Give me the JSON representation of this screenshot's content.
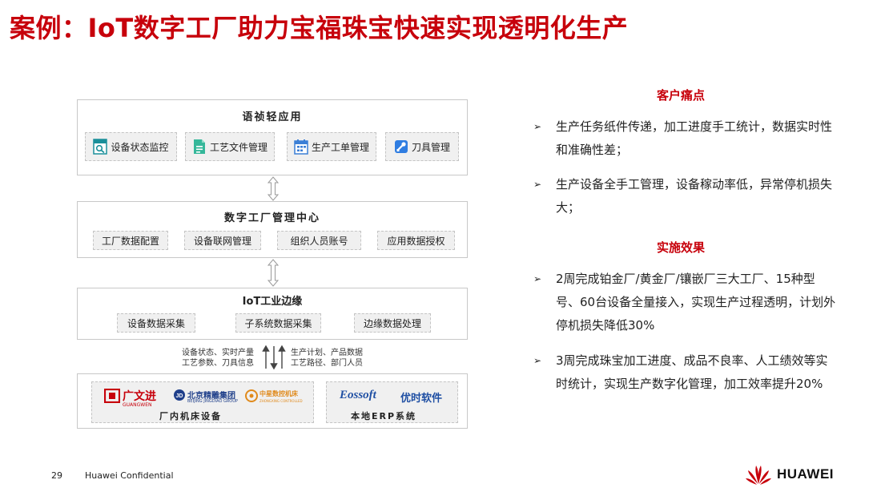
{
  "title": "案例：IoT数字工厂助力宝福珠宝快速实现透明化生产",
  "diagram": {
    "app_layer": {
      "title": "语祯轻应用",
      "apps": [
        {
          "label": "设备状态监控",
          "icon": "monitor-search-icon"
        },
        {
          "label": "工艺文件管理",
          "icon": "document-icon"
        },
        {
          "label": "生产工单管理",
          "icon": "calendar-icon"
        },
        {
          "label": "刀具管理",
          "icon": "tool-icon"
        }
      ]
    },
    "center_layer": {
      "title": "数字工厂管理中心",
      "items": [
        "工厂数据配置",
        "设备联网管理",
        "组织人员账号",
        "应用数据授权"
      ]
    },
    "edge_layer": {
      "title": "IoT工业边缘",
      "items": [
        "设备数据采集",
        "子系统数据采集",
        "边缘数据处理"
      ]
    },
    "flow": {
      "up_lines": [
        "设备状态、实时产量",
        "工艺参数、刀具信息"
      ],
      "down_lines": [
        "生产计划、产品数据",
        "工艺路径、部门人员"
      ]
    },
    "bottom": {
      "machine_caption": "厂内机床设备",
      "machine_brands": [
        {
          "name": "广文进",
          "sub": "GUANGWEN"
        },
        {
          "name": "北京精雕集团",
          "sub": "BEIJING JINGDIAO GROUP"
        },
        {
          "name": "中星数控机床",
          "sub": "ZHONGXING CONTROLLED"
        }
      ],
      "erp_caption": "本地ERP系统",
      "erp_brand": "Eossoft",
      "erp_brand_cn": "优时软件"
    }
  },
  "pain_points": {
    "heading": "客户痛点",
    "items": [
      "生产任务纸件传递，加工进度手工统计，数据实时性和准确性差；",
      "生产设备全手工管理，设备稼动率低，异常停机损失大；"
    ]
  },
  "effects": {
    "heading": "实施效果",
    "items": [
      "2周完成铂金厂/黄金厂/镶嵌厂三大工厂、15种型号、60台设备全量接入，实现生产过程透明，计划外停机损失降低30%",
      "3周完成珠宝加工进度、成品不良率、人工绩效等实时统计，实现生产数字化管理，加工效率提升20%"
    ]
  },
  "footer": {
    "page_number": "29",
    "confidential": "Huawei Confidential",
    "logo_text": "HUAWEI"
  },
  "colors": {
    "accent": "#c7000b",
    "box_fill": "#f0f0f0",
    "border": "#c8c8c8"
  }
}
